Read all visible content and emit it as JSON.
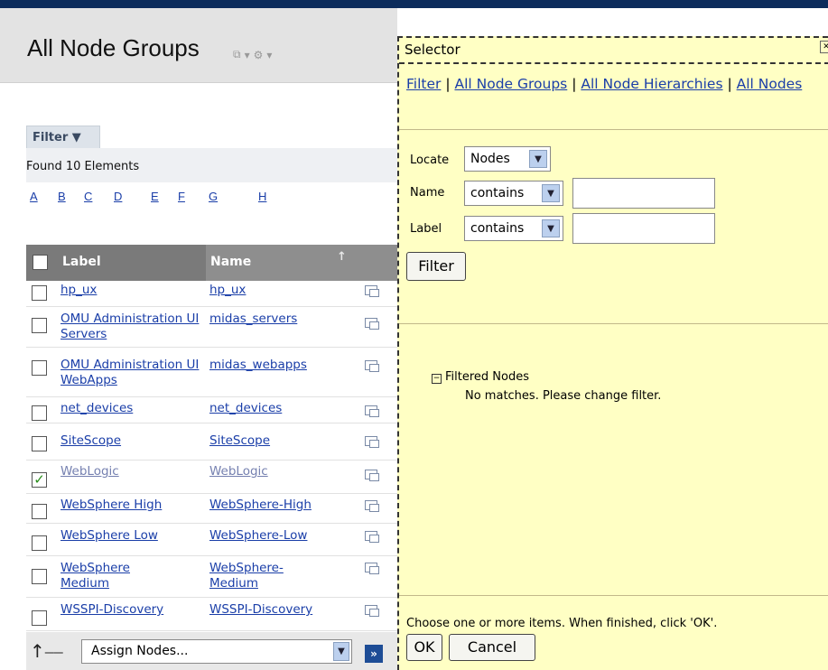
{
  "page": {
    "title": "All Node Groups"
  },
  "filter": {
    "tab_label": "Filter",
    "found_text": "Found 10 Elements"
  },
  "alpha_index": [
    "A",
    "B",
    "C",
    "D",
    "E",
    "F",
    "G",
    "H"
  ],
  "table": {
    "headers": {
      "label": "Label",
      "name": "Name"
    },
    "rows": [
      {
        "label": "hp_ux",
        "name": "hp_ux",
        "checked": false
      },
      {
        "label": "OMU Administration UI Servers",
        "name": "midas_servers",
        "checked": false
      },
      {
        "label": "OMU Administration UI WebApps",
        "name": "midas_webapps",
        "checked": false
      },
      {
        "label": "net_devices",
        "name": "net_devices",
        "checked": false
      },
      {
        "label": "SiteScope",
        "name": "SiteScope",
        "checked": false
      },
      {
        "label": "WebLogic",
        "name": "WebLogic",
        "checked": true
      },
      {
        "label": "WebSphere High",
        "name": "WebSphere-High",
        "checked": false
      },
      {
        "label": "WebSphere Low",
        "name": "WebSphere-Low",
        "checked": false
      },
      {
        "label": "WebSphere Medium",
        "name": "WebSphere-Medium",
        "checked": false
      },
      {
        "label": "WSSPI-Discovery",
        "name": "WSSPI-Discovery",
        "checked": false
      }
    ]
  },
  "bottom": {
    "action_select": "Assign Nodes..."
  },
  "selector": {
    "title": "Selector",
    "nav": {
      "filter": "Filter",
      "sep": " | ",
      "node_groups": "All Node Groups",
      "hierarchies": "All Node Hierarchies",
      "nodes": "All Nodes"
    },
    "locate_label": "Locate",
    "locate_value": "Nodes",
    "name_label": "Name",
    "name_op": "contains",
    "name_value": "",
    "label_label": "Label",
    "label_op": "contains",
    "label_value": "",
    "filter_button": "Filter",
    "tree_root": "Filtered Nodes",
    "no_matches": "No matches. Please change filter.",
    "help": "Choose one or more items. When finished, click 'OK'.",
    "ok_button": "OK",
    "cancel_button": "Cancel"
  }
}
